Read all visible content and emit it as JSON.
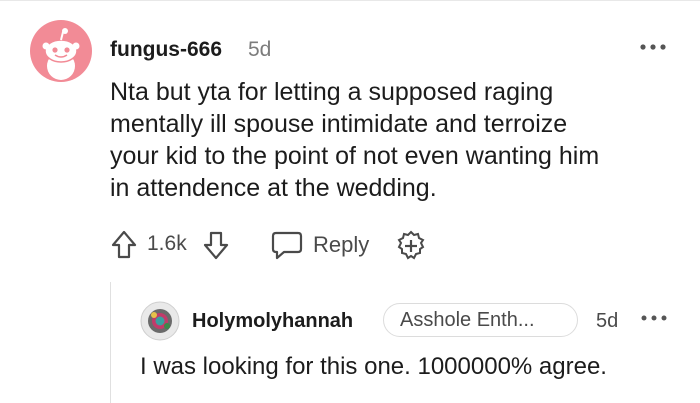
{
  "comment": {
    "author": "fungus-666",
    "age": "5d",
    "avatar_icon": "snoo-avatar-icon",
    "body_lines": [
      "Nta but yta for letting a supposed raging",
      "mentally ill spouse intimidate and terroize",
      "your kid to the point of not even wanting him",
      "in attendence at the wedding."
    ],
    "score": "1.6k",
    "reply_label": "Reply",
    "avatar_color": "#f28b96"
  },
  "reply": {
    "author": "Holymolyhannah",
    "flair": "Asshole Enth...",
    "age": "5d",
    "avatar_icon": "user-avatar-icon",
    "body": "I was looking for this one. 1000000% agree."
  }
}
